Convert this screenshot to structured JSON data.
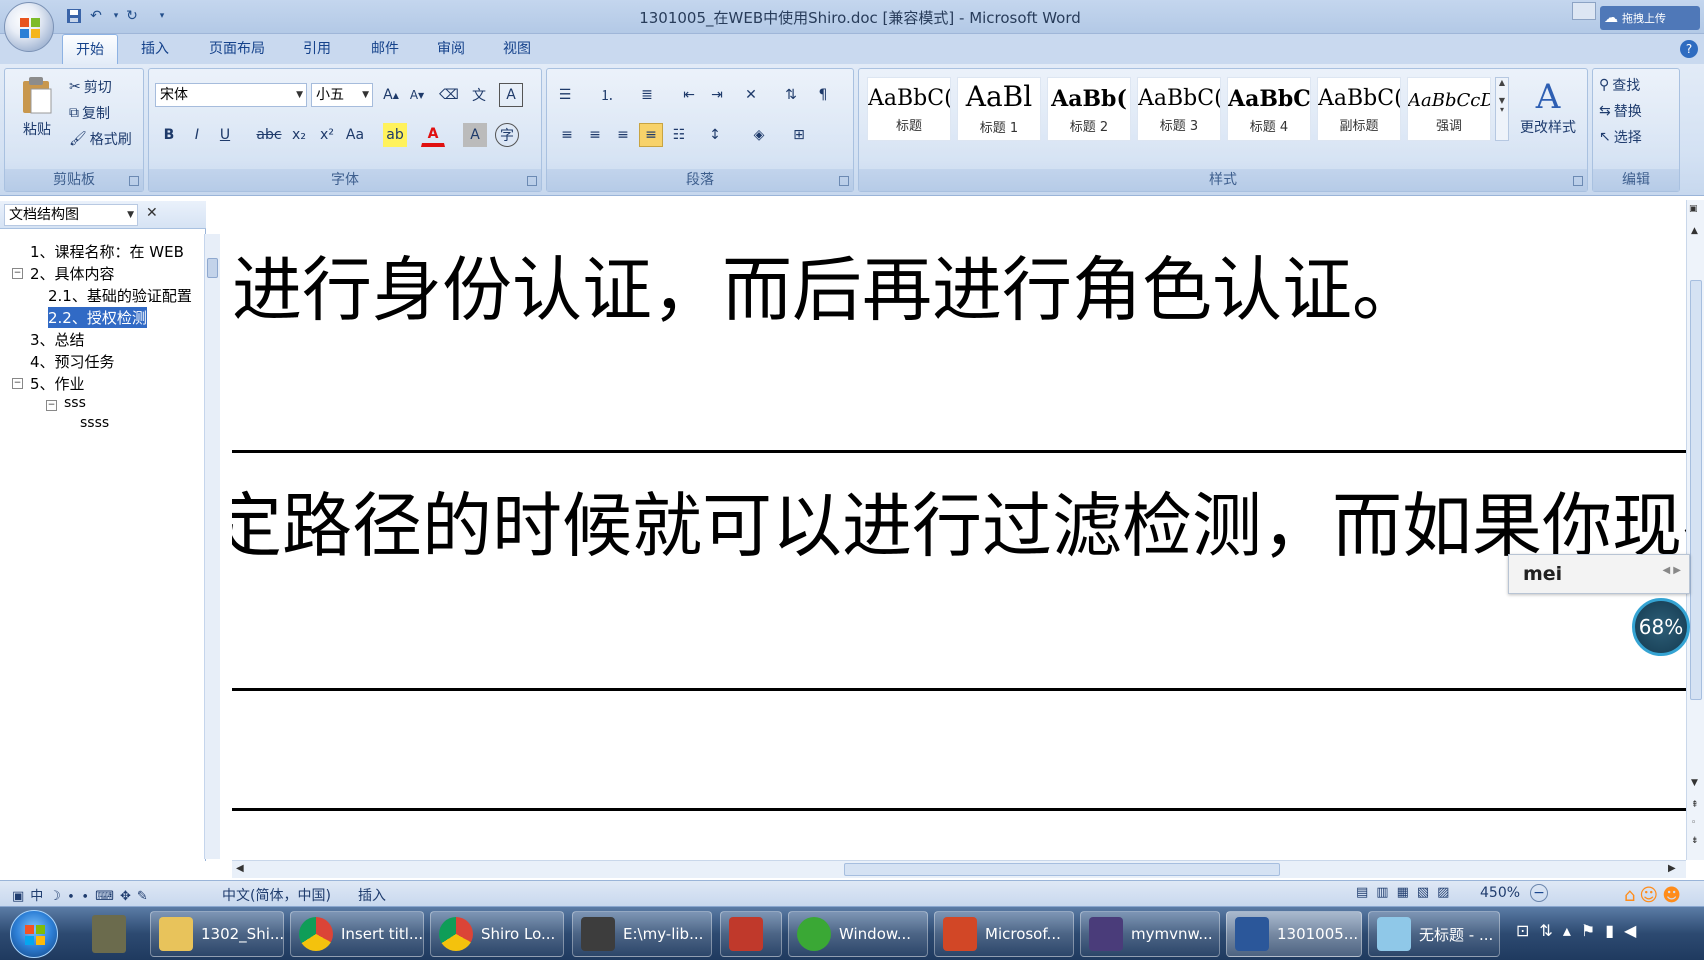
{
  "window": {
    "title": "1301005_在WEB中使用Shiro.doc [兼容模式] - Microsoft Word",
    "upload_label": "拖拽上传"
  },
  "quick_access": [
    "save-icon",
    "undo-icon",
    "redo-icon",
    "customize-icon"
  ],
  "tabs": [
    "开始",
    "插入",
    "页面布局",
    "引用",
    "邮件",
    "审阅",
    "视图"
  ],
  "clipboard": {
    "paste": "粘贴",
    "cut": "剪切",
    "copy": "复制",
    "format_painter": "格式刷",
    "label": "剪贴板"
  },
  "font": {
    "name": "宋体",
    "size": "小五",
    "label": "字体"
  },
  "paragraph": {
    "label": "段落"
  },
  "styles": {
    "label": "样式",
    "change_styles": "更改样式",
    "items": [
      {
        "sample": "AaBbC(",
        "name": "标题"
      },
      {
        "sample": "AaBl",
        "name": "标题 1"
      },
      {
        "sample": "AaBb(",
        "name": "标题 2"
      },
      {
        "sample": "AaBbC(",
        "name": "标题 3"
      },
      {
        "sample": "AaBbC(",
        "name": "标题 4"
      },
      {
        "sample": "AaBbC(",
        "name": "副标题"
      },
      {
        "sample": "AaBbCcD(",
        "name": "强调"
      }
    ]
  },
  "editing": {
    "find": "查找",
    "replace": "替换",
    "select": "选择",
    "label": "编辑"
  },
  "nav_pane": {
    "title": "文档结构图",
    "items": [
      {
        "text": "1、课程名称：在 WEB",
        "level": 0
      },
      {
        "text": "2、具体内容",
        "level": 0
      },
      {
        "text": "2.1、基础的验证配置",
        "level": 1
      },
      {
        "text": "2.2、授权检测",
        "level": 1
      },
      {
        "text": "3、总结",
        "level": 0
      },
      {
        "text": "4、预习任务",
        "level": 0
      },
      {
        "text": "5、作业",
        "level": 0
      },
      {
        "text": "sss",
        "level": 1
      },
      {
        "text": "ssss",
        "level": 2
      }
    ]
  },
  "document": {
    "line1": "进行身份认证，而后再进行角色认证。",
    "line2": "定路径的时候就可以进行过滤检测，而如果你现在"
  },
  "ime": {
    "input": "mei"
  },
  "zoom_bubble": "68%",
  "status": {
    "language": "中文(简体，中国)",
    "mode": "插入",
    "zoom": "450%"
  },
  "taskbar": {
    "items": [
      "1302_Shi...",
      "Insert titl...",
      "Shiro Lo...",
      "E:\\my-lib...",
      "",
      "Window...",
      "Microsof...",
      "mymvnw...",
      "1301005...",
      "无标题 - ..."
    ]
  }
}
